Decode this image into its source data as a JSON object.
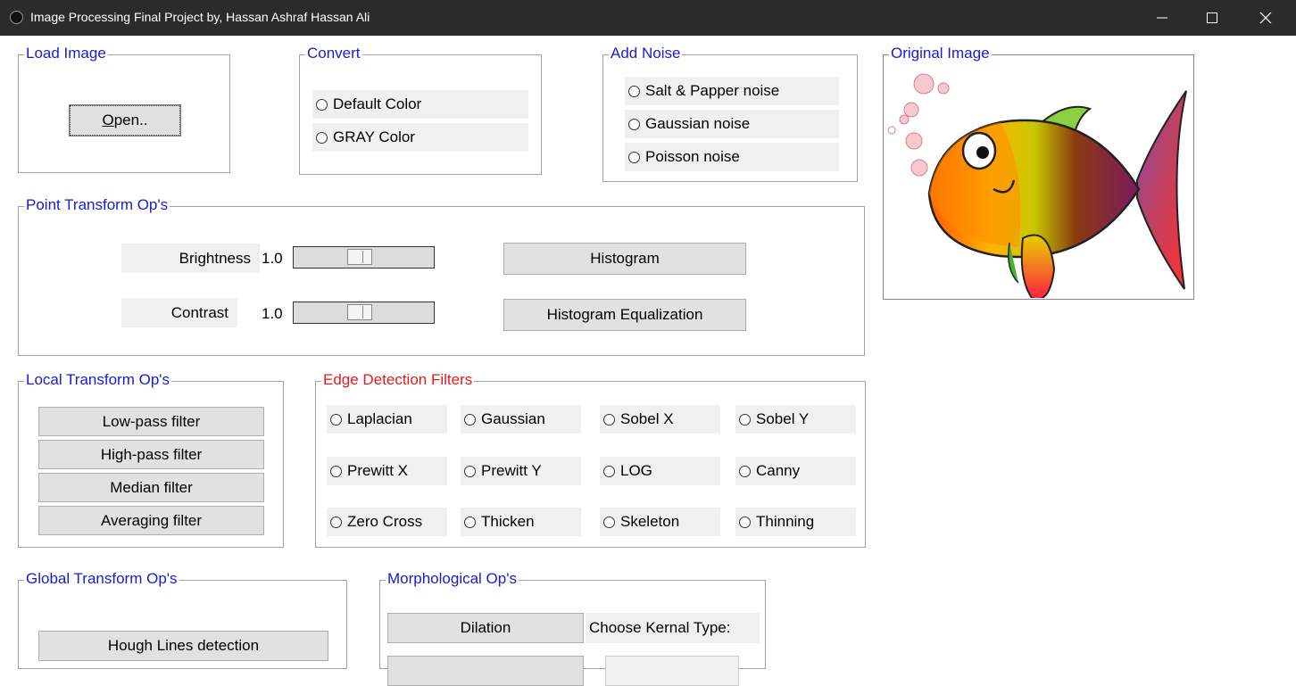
{
  "window": {
    "title": "Image Processing Final Project by, Hassan Ashraf Hassan Ali"
  },
  "load_image": {
    "legend": "Load Image",
    "open_label": "Open.."
  },
  "convert": {
    "legend": "Convert",
    "options": [
      "Default Color",
      "GRAY Color"
    ]
  },
  "add_noise": {
    "legend": "Add Noise",
    "options": [
      "Salt & Papper noise",
      "Gaussian noise",
      "Poisson noise"
    ]
  },
  "original_image": {
    "legend": "Original Image"
  },
  "point_transform": {
    "legend": "Point Transform Op's",
    "brightness_label": "Brightness",
    "brightness_value": "1.0",
    "brightness_level": 0.38,
    "contrast_label": "Contrast",
    "contrast_value": "1.0",
    "contrast_level": 0.38,
    "histogram_label": "Histogram",
    "histogram_eq_label": "Histogram Equalization"
  },
  "local_transform": {
    "legend": "Local Transform Op's",
    "buttons": [
      "Low-pass filter",
      "High-pass filter",
      "Median filter",
      "Averaging filter"
    ]
  },
  "edge_detection": {
    "legend": "Edge Detection Filters",
    "options": [
      "Laplacian",
      "Gaussian",
      "Sobel X",
      "Sobel Y",
      "Prewitt X",
      "Prewitt Y",
      "LOG",
      "Canny",
      "Zero Cross",
      "Thicken",
      "Skeleton",
      "Thinning"
    ]
  },
  "global_transform": {
    "legend": "Global Transform Op's",
    "hough_label": "Hough Lines detection"
  },
  "morphological": {
    "legend": "Morphological Op's",
    "dilation_label": "Dilation",
    "kernel_label": "Choose Kernal Type:"
  },
  "colors": {
    "titlebar": "#2b2b2b",
    "legend_blue": "#1a1ad6",
    "legend_red": "#e41b1b"
  }
}
